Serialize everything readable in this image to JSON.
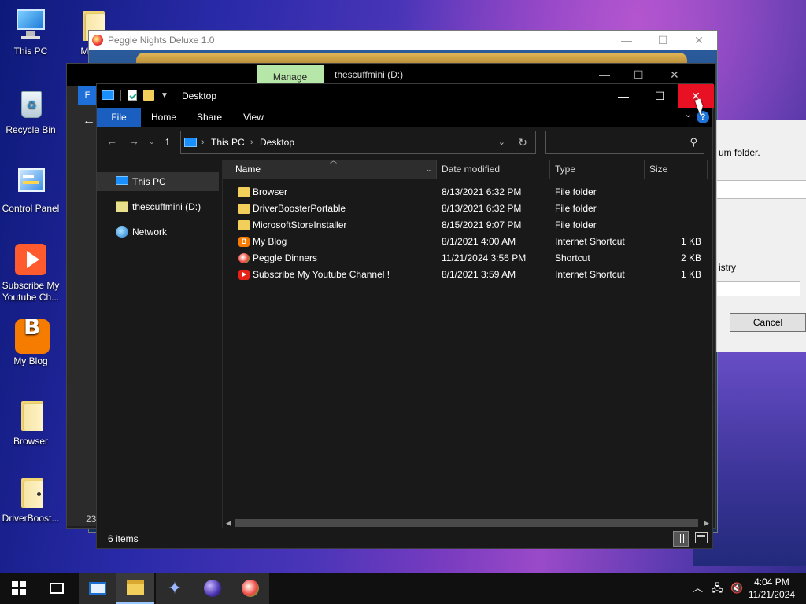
{
  "desktop": {
    "icons": [
      {
        "label": "This PC"
      },
      {
        "label": "Recycle Bin"
      },
      {
        "label": "Control Panel"
      },
      {
        "label": "Subscribe My Youtube Ch..."
      },
      {
        "label": "My Blog"
      },
      {
        "label": "Browser"
      },
      {
        "label": "DriverBoost..."
      },
      {
        "label": "Micro"
      }
    ]
  },
  "peggle_window": {
    "title": "Peggle Nights Deluxe 1.0",
    "controls": {
      "minimize": "—",
      "maximize": "☐",
      "close": "✕"
    }
  },
  "explorer_bg": {
    "manage_tab": "Manage",
    "drive_title": "thescuffmini (D:)",
    "file_tab_fragment": "F",
    "number_fragment": "23"
  },
  "dialog_bg": {
    "text1": "um folder.",
    "text2": "istry",
    "cancel_label": "Cancel"
  },
  "explorer": {
    "title": "Desktop",
    "controls": {
      "minimize": "—",
      "maximize": "☐",
      "close": "✕"
    },
    "ribbon_tabs": [
      "File",
      "Home",
      "Share",
      "View"
    ],
    "help": "?",
    "address": {
      "crumbs": [
        "This PC",
        "Desktop"
      ],
      "separator": "›"
    },
    "search": {
      "placeholder": ""
    },
    "nav_pane": [
      {
        "label": "This PC",
        "icon": "pc-icon",
        "selected": true
      },
      {
        "label": "thescuffmini (D:)",
        "icon": "drive-icon",
        "selected": false
      },
      {
        "label": "Network",
        "icon": "network-icon",
        "selected": false
      }
    ],
    "columns": {
      "name": "Name",
      "date": "Date modified",
      "type": "Type",
      "size": "Size"
    },
    "files": [
      {
        "name": "Browser",
        "date": "8/13/2021 6:32 PM",
        "type": "File folder",
        "size": "",
        "icon": "folder-icon"
      },
      {
        "name": "DriverBoosterPortable",
        "date": "8/13/2021 6:32 PM",
        "type": "File folder",
        "size": "",
        "icon": "folder-icon"
      },
      {
        "name": "MicrosoftStoreInstaller",
        "date": "8/15/2021 9:07 PM",
        "type": "File folder",
        "size": "",
        "icon": "folder-icon"
      },
      {
        "name": "My Blog",
        "date": "8/1/2021 4:00 AM",
        "type": "Internet Shortcut",
        "size": "1 KB",
        "icon": "blogger-icon"
      },
      {
        "name": "Peggle Dinners",
        "date": "11/21/2024 3:56 PM",
        "type": "Shortcut",
        "size": "2 KB",
        "icon": "peggle-icon"
      },
      {
        "name": "Subscribe My Youtube Channel !",
        "date": "8/1/2021 3:59 AM",
        "type": "Internet Shortcut",
        "size": "1 KB",
        "icon": "youtube-icon"
      }
    ],
    "status": {
      "items": "6 items"
    }
  },
  "taskbar": {
    "clock_time": "4:04 PM",
    "clock_date": "11/21/2024"
  }
}
